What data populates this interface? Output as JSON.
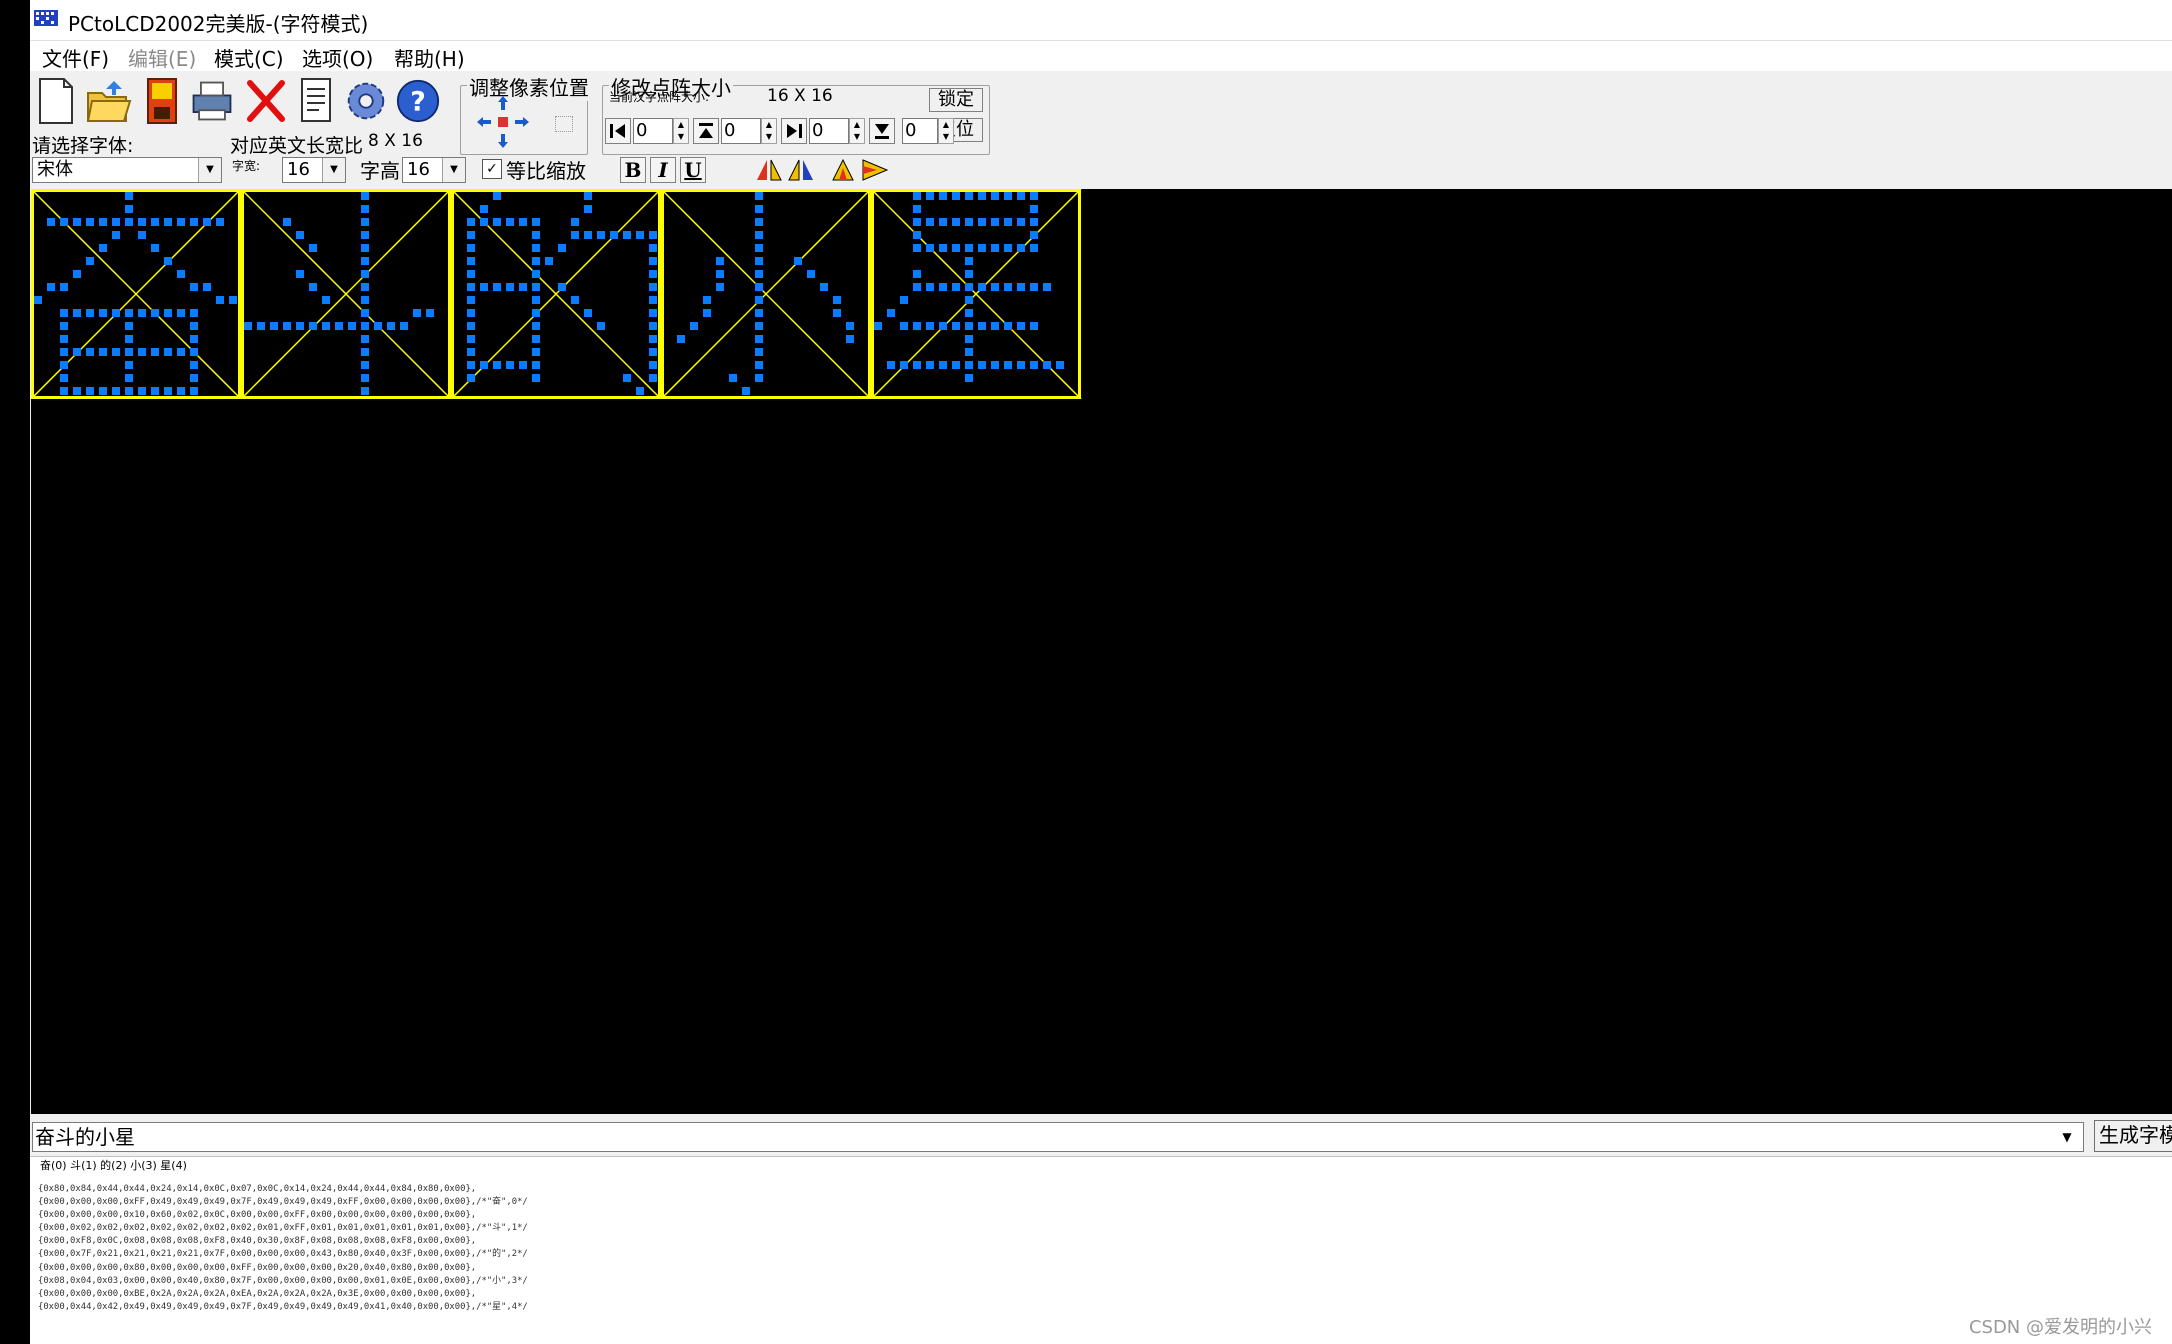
{
  "window": {
    "title": "PCtoLCD2002完美版-(字符模式)"
  },
  "menu": [
    {
      "label": "文件(F)",
      "enabled": true
    },
    {
      "label": "编辑(E)",
      "enabled": false
    },
    {
      "label": "模式(C)",
      "enabled": true
    },
    {
      "label": "选项(O)",
      "enabled": true
    },
    {
      "label": "帮助(H)",
      "enabled": true
    }
  ],
  "toolbar": {
    "icons": [
      "new-file-icon",
      "open-folder-icon",
      "save-icon",
      "print-icon",
      "delete-icon",
      "notepad-icon",
      "settings-gear-icon",
      "help-icon"
    ],
    "font_label": "请选择字体:",
    "font_value": "宋体",
    "ratio_label": "对应英文长宽比",
    "ratio_value": "8 X 16",
    "width_label": "字宽:",
    "width_value": "16",
    "height_label": "字高",
    "height_value": "16",
    "proportional_label": "等比缩放",
    "proportional_checked": true,
    "bold_label": "B",
    "italic_label": "I",
    "underline_label": "U",
    "adjust_group_title": "调整像素位置",
    "matrix_group_title": "修改点阵大小",
    "current_size_label": "当前汉字点阵大小:",
    "current_size_value": "16 X 16",
    "lock_button": "锁定",
    "reset_button": "复位",
    "spin_values": [
      "0",
      "0",
      "0",
      "0"
    ]
  },
  "canvas": {
    "grid_color": "#ffff00",
    "dot_color": "#0a7cff",
    "background": "#000000",
    "characters": [
      {
        "char": "奋",
        "rows": [
          "0000000100000000",
          "0000000100000000",
          "0111111111111110",
          "0000001010000000",
          "0000010001000000",
          "0000100000100000",
          "0001000000010000",
          "0110000000001100",
          "1000000000000011",
          "0011111111111000",
          "0010000100001000",
          "0010000100001000",
          "0011111111111000",
          "0010000100001000",
          "0010000100001000",
          "0011111111111000"
        ]
      },
      {
        "char": "斗",
        "rows": [
          "0000000001000000",
          "0000000001000000",
          "0001000001000000",
          "0000100001000000",
          "0000010001000000",
          "0000000001000000",
          "0000100001000000",
          "0000010001000000",
          "0000001001000000",
          "0000000001000110",
          "1111111111111000",
          "0000000001000000",
          "0000000001000000",
          "0000000001000000",
          "0000000001000000",
          "0000000001000000"
        ]
      },
      {
        "char": "的",
        "rows": [
          "0001000000100000",
          "0010000000100000",
          "0111111001000000",
          "0100001001111111",
          "0100001010000001",
          "0100001100000001",
          "0100001000000001",
          "0111111010000001",
          "0100001001000001",
          "0100001000100001",
          "0100001000010001",
          "0100001000000001",
          "0100001000000001",
          "0111111000000001",
          "0100001000000101",
          "0000000000000010"
        ]
      },
      {
        "char": "小",
        "rows": [
          "0000000100000000",
          "0000000100000000",
          "0000000100000000",
          "0000000100000000",
          "0000000100000000",
          "0000100100100000",
          "0000100100010000",
          "0000100100001000",
          "0001000100000100",
          "0001000100000100",
          "0010000100000010",
          "0100000100000010",
          "0000000100000000",
          "0000000100000000",
          "0000010100000000",
          "0000001000000000"
        ]
      },
      {
        "char": "星",
        "rows": [
          "0001111111111000",
          "0001000000001000",
          "0001111111111000",
          "0001000000001000",
          "0001111111111000",
          "0000000100000000",
          "0001000100000000",
          "0001111111111100",
          "0010000100000000",
          "0100000100000000",
          "1011111111111000",
          "0000000100000000",
          "0000000100000000",
          "0111111111111110",
          "0000000100000000",
          "0000000000000000"
        ]
      }
    ]
  },
  "text_input": {
    "value": "奋斗的小星"
  },
  "generate_button": "生成字模",
  "output": {
    "tabs": "奋(0)  斗(1)  的(2)  小(3)  星(4)",
    "lines": [
      "{0x80,0x84,0x44,0x44,0x24,0x14,0x0C,0x07,0x0C,0x14,0x24,0x44,0x44,0x84,0x80,0x00},",
      "{0x00,0x00,0x00,0xFF,0x49,0x49,0x49,0x7F,0x49,0x49,0x49,0xFF,0x00,0x00,0x00,0x00},/*\"奋\",0*/",
      "{0x00,0x00,0x00,0x10,0x60,0x02,0x0C,0x00,0x00,0xFF,0x00,0x00,0x00,0x00,0x00,0x00},",
      "{0x00,0x02,0x02,0x02,0x02,0x02,0x02,0x02,0x01,0xFF,0x01,0x01,0x01,0x01,0x01,0x00},/*\"斗\",1*/",
      "{0x00,0xF8,0x0C,0x08,0x08,0x08,0xF8,0x40,0x30,0x8F,0x08,0x08,0x08,0xF8,0x00,0x00},",
      "{0x00,0x7F,0x21,0x21,0x21,0x21,0x7F,0x00,0x00,0x00,0x43,0x80,0x40,0x3F,0x00,0x00},/*\"的\",2*/",
      "{0x00,0x00,0x00,0x80,0x00,0x00,0x00,0xFF,0x00,0x00,0x00,0x20,0x40,0x80,0x00,0x00},",
      "{0x08,0x04,0x03,0x00,0x00,0x40,0x80,0x7F,0x00,0x00,0x00,0x00,0x01,0x0E,0x00,0x00},/*\"小\",3*/",
      "{0x00,0x00,0x00,0xBE,0x2A,0x2A,0x2A,0xEA,0x2A,0x2A,0x2A,0x3E,0x00,0x00,0x00,0x00},",
      "{0x00,0x44,0x42,0x49,0x49,0x49,0x49,0x7F,0x49,0x49,0x49,0x49,0x41,0x40,0x00,0x00},/*\"星\",4*/"
    ]
  },
  "watermark": "CSDN @爱发明的小兴"
}
